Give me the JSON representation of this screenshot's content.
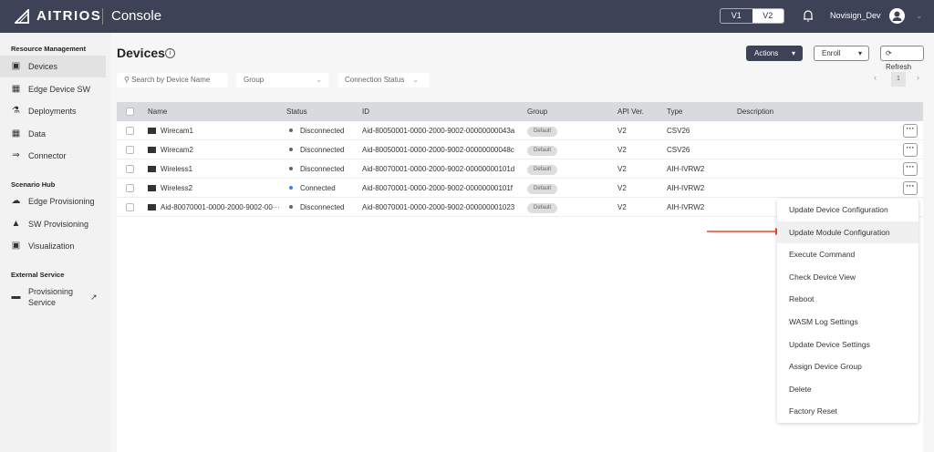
{
  "header": {
    "brand": "AITRIOS",
    "app": "Console",
    "versions": [
      "V1",
      "V2"
    ],
    "active_version": "V2",
    "user": "Novisign_Dev"
  },
  "sidebar": {
    "sections": [
      {
        "title": "Resource Management",
        "items": [
          {
            "label": "Devices",
            "icon": "device-icon",
            "active": true
          },
          {
            "label": "Edge Device SW",
            "icon": "grid-icon"
          },
          {
            "label": "Deployments",
            "icon": "hierarchy-icon"
          },
          {
            "label": "Data",
            "icon": "data-grid-icon"
          },
          {
            "label": "Connector",
            "icon": "connector-icon"
          }
        ]
      },
      {
        "title": "Scenario Hub",
        "items": [
          {
            "label": "Edge Provisioning",
            "icon": "cloud-icon"
          },
          {
            "label": "SW Provisioning",
            "icon": "sw-provisioning-icon"
          },
          {
            "label": "Visualization",
            "icon": "visualization-icon"
          }
        ]
      },
      {
        "title": "External Service",
        "items": [
          {
            "label": "Provisioning Service",
            "icon": "window-icon"
          }
        ]
      }
    ]
  },
  "page": {
    "title": "Devices",
    "actions": "Actions",
    "enroll": "Enroll",
    "refresh": "Refresh",
    "search_placeholder": "Search by Device Name",
    "group_filter": "Group",
    "status_filter": "Connection Status",
    "page": "1"
  },
  "table": {
    "columns": [
      "Name",
      "Status",
      "ID",
      "Group",
      "API Ver.",
      "Type",
      "Description"
    ],
    "rows": [
      {
        "name": "Wirecam1",
        "status": "Disconnected",
        "id": "Aid-80050001-0000-2000-9002-00000000043a",
        "group": "Default",
        "api": "V2",
        "type": "CSV26",
        "description": ""
      },
      {
        "name": "Wirecam2",
        "status": "Disconnected",
        "id": "Aid-80050001-0000-2000-9002-00000000048c",
        "group": "Default",
        "api": "V2",
        "type": "CSV26",
        "description": ""
      },
      {
        "name": "Wireless1",
        "status": "Disconnected",
        "id": "Aid-80070001-0000-2000-9002-00000000101d",
        "group": "Default",
        "api": "V2",
        "type": "AIH-IVRW2",
        "description": ""
      },
      {
        "name": "Wireless2",
        "status": "Connected",
        "id": "Aid-80070001-0000-2000-9002-00000000101f",
        "group": "Default",
        "api": "V2",
        "type": "AIH-IVRW2",
        "description": ""
      },
      {
        "name": "Aid-80070001-0000-2000-9002-00···",
        "status": "Disconnected",
        "id": "Aid-80070001-0000-2000-9002-000000001023",
        "group": "Default",
        "api": "V2",
        "type": "AIH-IVRW2",
        "description": ""
      }
    ]
  },
  "colors": {
    "header": "#3d4256",
    "connected": "#3b82f6",
    "disconnected": "#666666",
    "arrow": "#e8482c"
  },
  "menu": {
    "items": [
      "Update Device Configuration",
      "Update Module Configuration",
      "Execute Command",
      "Check Device View",
      "Reboot",
      "WASM Log Settings",
      "Update Device Settings",
      "Assign Device Group",
      "Delete",
      "Factory Reset"
    ],
    "highlighted": "Update Module Configuration"
  }
}
